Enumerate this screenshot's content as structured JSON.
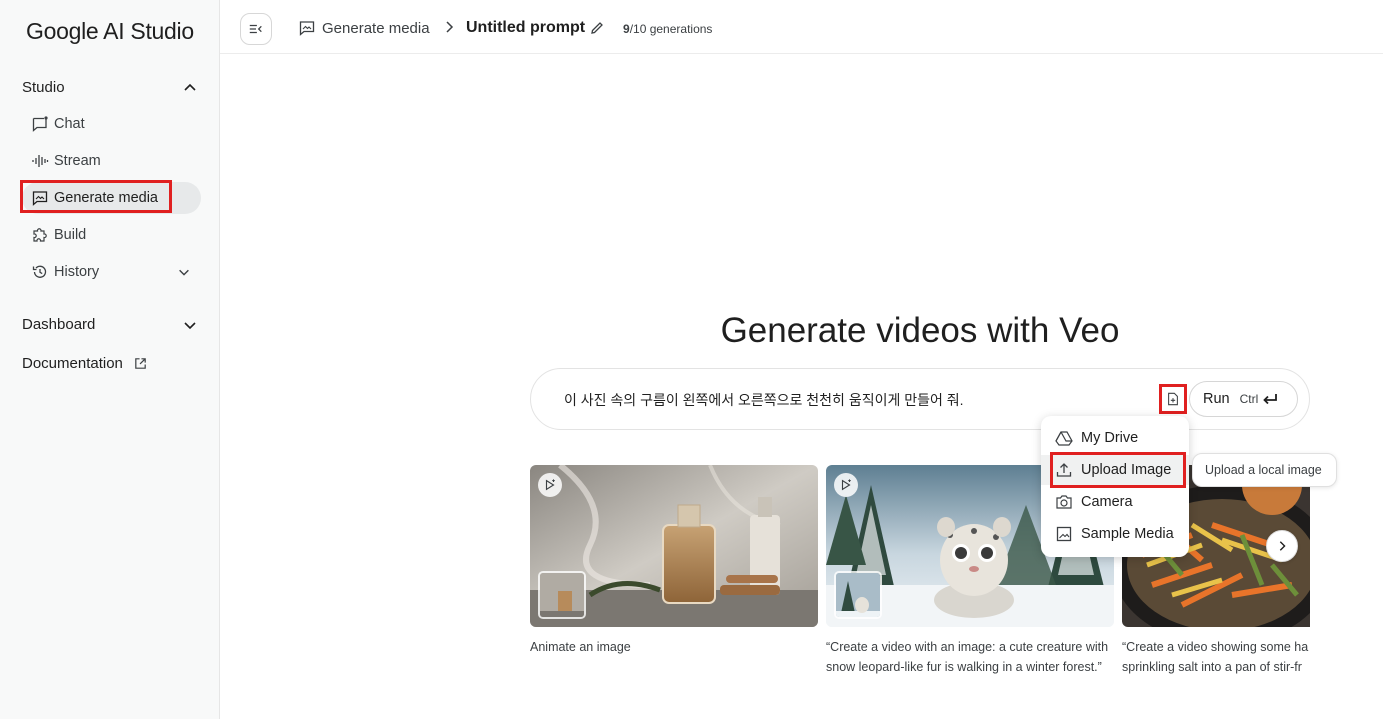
{
  "app": {
    "logo": "Google AI Studio"
  },
  "sidebar": {
    "studio_label": "Studio",
    "items": [
      {
        "label": "Chat",
        "icon": "chat-icon"
      },
      {
        "label": "Stream",
        "icon": "waveform-icon"
      },
      {
        "label": "Generate media",
        "icon": "image-chat-icon",
        "active": true
      },
      {
        "label": "Build",
        "icon": "puzzle-icon"
      },
      {
        "label": "History",
        "icon": "history-icon"
      }
    ],
    "dashboard_label": "Dashboard",
    "documentation_label": "Documentation"
  },
  "topbar": {
    "breadcrumb_section": "Generate media",
    "prompt_title": "Untitled prompt",
    "generations_used": "9",
    "generations_rest": "/10 generations"
  },
  "main": {
    "title": "Generate videos with Veo",
    "prompt_text": "이 사진 속의 구름이 왼쪽에서 오른쪽으로 천천히 움직이게 만들어 줘.",
    "run_label": "Run",
    "run_shortcut": "Ctrl"
  },
  "cards": [
    {
      "caption": "Animate an image"
    },
    {
      "caption": "“Create a video with an image: a cute creature with snow leopard-like fur is walking in a winter forest.”"
    },
    {
      "caption": "“Create a video showing some ha sprinkling salt into a pan of stir-fr"
    }
  ],
  "menu": {
    "items": [
      {
        "label": "My Drive",
        "icon": "drive-icon"
      },
      {
        "label": "Upload Image",
        "icon": "upload-icon"
      },
      {
        "label": "Camera",
        "icon": "camera-icon"
      },
      {
        "label": "Sample Media",
        "icon": "image-icon"
      }
    ],
    "tooltip": "Upload a local image"
  },
  "colors": {
    "highlight": "#e02020",
    "active_bg": "#e7e9ea"
  }
}
